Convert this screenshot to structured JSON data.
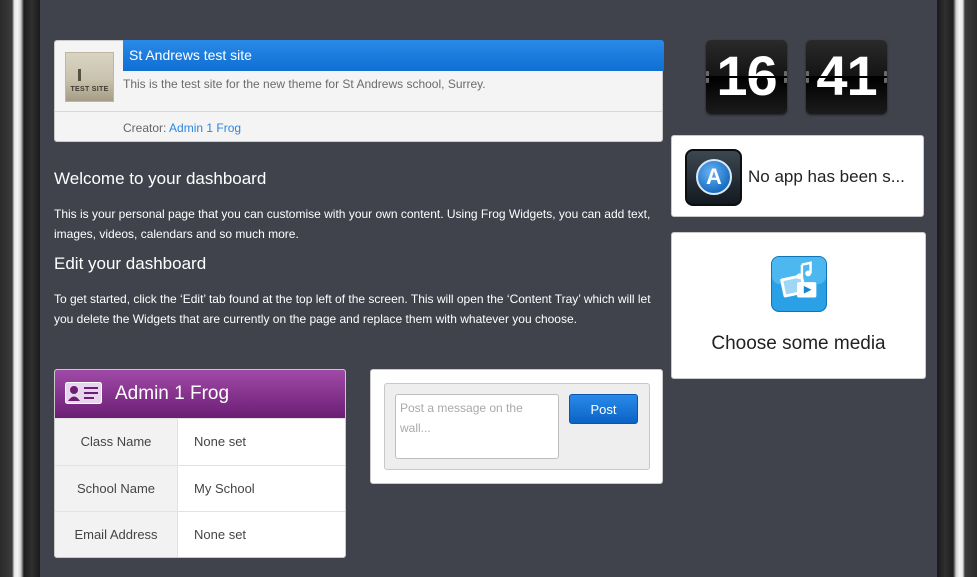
{
  "site_card": {
    "thumbnail_text": "TEST SITE",
    "title": "St Andrews test site",
    "description": "This is the test site for the new theme for St Andrews school, Surrey.",
    "creator_label": "Creator:",
    "creator_name": "Admin 1 Frog"
  },
  "welcome": {
    "heading": "Welcome to your dashboard",
    "body": "This is your personal page that you can customise with your own content. Using Frog Widgets, you can add text, images, videos, calendars and so much more."
  },
  "edit": {
    "heading": "Edit your dashboard",
    "body": "To get started, click the ‘Edit’ tab found at the top left of the screen. This will open the ‘Content Tray’ which will let you delete the Widgets that are currently on the page and replace them with whatever you choose."
  },
  "profile": {
    "name": "Admin 1 Frog",
    "rows": [
      {
        "label": "Class Name",
        "value": "None set"
      },
      {
        "label": "School Name",
        "value": "My School"
      },
      {
        "label": "Email Address",
        "value": "None set"
      }
    ]
  },
  "wall": {
    "placeholder": "Post a message on the wall...",
    "post_label": "Post"
  },
  "clock": {
    "hours": "16",
    "minutes": "41"
  },
  "app_widget": {
    "icon_letter": "A",
    "text": "No app has been s..."
  },
  "media_widget": {
    "text": "Choose some media"
  },
  "colors": {
    "background": "#40434c",
    "site_title_bar": "#1a7ddd",
    "profile_header": "#8a3592",
    "post_button": "#1a7ddd",
    "link": "#2c86e0"
  },
  "icons": {
    "profile": "id-card-icon",
    "app": "app-store-icon",
    "media": "media-icon"
  }
}
